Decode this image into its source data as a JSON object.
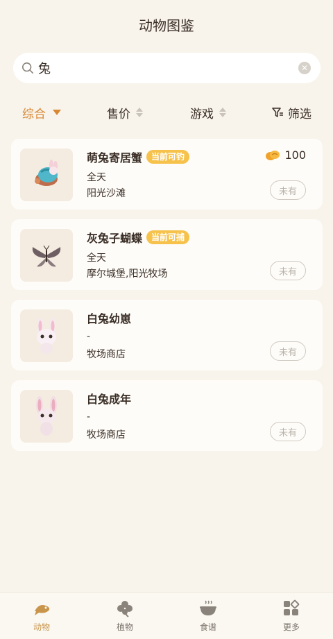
{
  "header": {
    "title": "动物图鉴"
  },
  "search": {
    "query": "兔"
  },
  "sort": {
    "items": [
      {
        "label": "综合",
        "active": true
      },
      {
        "label": "售价"
      },
      {
        "label": "游戏"
      },
      {
        "label": "筛选"
      }
    ]
  },
  "cards": [
    {
      "name": "萌兔寄居蟹",
      "tag": "当前可钓",
      "time": "全天",
      "location": "阳光沙滩",
      "price": "100",
      "ownership": "未有"
    },
    {
      "name": "灰兔子蝴蝶",
      "tag": "当前可捕",
      "time": "全天",
      "location": "摩尔城堡,阳光牧场",
      "ownership": "未有"
    },
    {
      "name": "白兔幼崽",
      "time": "-",
      "location": "牧场商店",
      "ownership": "未有"
    },
    {
      "name": "白兔成年",
      "time": "-",
      "location": "牧场商店",
      "ownership": "未有"
    }
  ],
  "tabs": [
    {
      "label": "动物",
      "icon": "fish-icon",
      "active": true
    },
    {
      "label": "植物",
      "icon": "clover-icon"
    },
    {
      "label": "食谱",
      "icon": "bowl-icon"
    },
    {
      "label": "更多",
      "icon": "grid-icon"
    }
  ],
  "colors": {
    "accent": "#d88732",
    "tag": "#f6c24b",
    "background": "#f8f4ec"
  }
}
